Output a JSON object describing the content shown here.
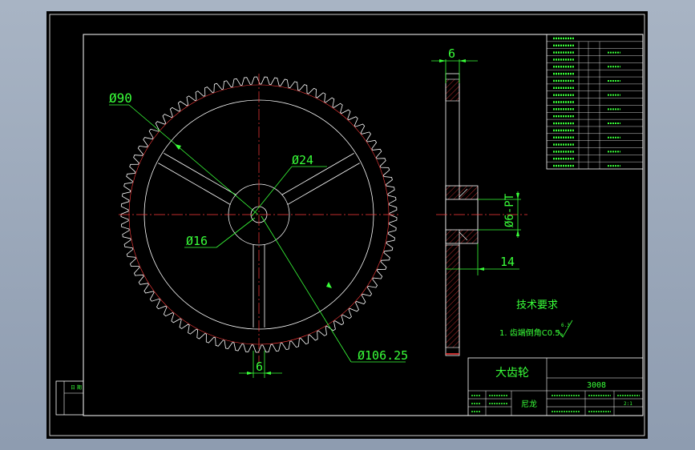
{
  "drawing": {
    "colors": {
      "background": "#000000",
      "outline": "#ffffff",
      "centerline": "#ff3b3b",
      "dimension": "#39ff39",
      "hatch": "#ff3b3b"
    },
    "front_view_dimensions": {
      "d_outer": "Ø106.25",
      "d_web": "Ø90",
      "d_hub": "Ø24",
      "d_bore": "Ø16",
      "spoke_width": "6"
    },
    "side_view_dimensions": {
      "thickness": "6",
      "hub_length": "14",
      "hub_dia": "Ø6-PT"
    },
    "gear_teeth": 85,
    "tech_requirements": {
      "title": "技术要求",
      "item1": "1. 齿端倒角C0.5。",
      "roughness": "6.3"
    },
    "title_block": {
      "part_name": "大齿轮",
      "drawing_no": "3008",
      "material": "尼龙",
      "scale": "2:1"
    },
    "side_margin_label": "日 期"
  }
}
